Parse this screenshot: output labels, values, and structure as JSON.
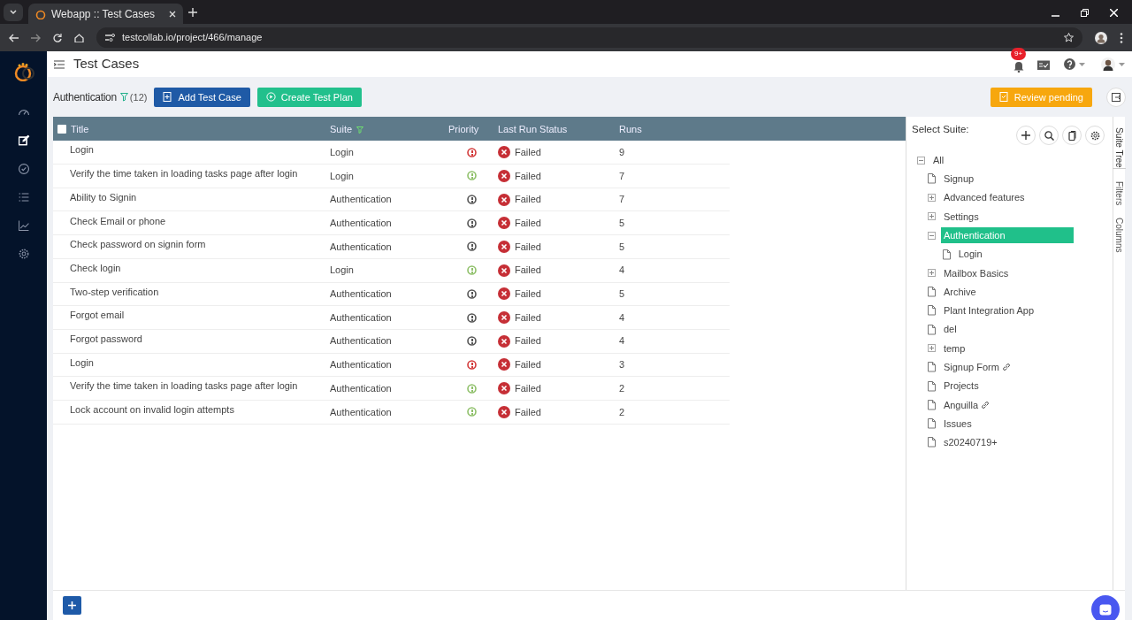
{
  "browser": {
    "tab_title": "Webapp :: Test Cases",
    "url": "testcollab.io/project/466/manage"
  },
  "sidebar": {
    "items": [
      {
        "kind": "dashboard",
        "selected": false
      },
      {
        "kind": "edit",
        "selected": true
      },
      {
        "kind": "check",
        "selected": false
      },
      {
        "kind": "list",
        "selected": false
      },
      {
        "kind": "chart",
        "selected": false
      },
      {
        "kind": "settings",
        "selected": false
      }
    ]
  },
  "header": {
    "title": "Test Cases",
    "notification_count": "9+"
  },
  "toolbar": {
    "suite_name": "Authentication",
    "count": "(12)",
    "buttons": [
      {
        "kind": "add",
        "label": "Add Test Case"
      },
      {
        "kind": "plan",
        "label": "Create Test Plan"
      },
      {
        "kind": "review",
        "label": "Review pending"
      }
    ]
  },
  "table": {
    "select_all_checked": false,
    "columns": [
      "Title",
      "Suite",
      "Priority",
      "Last Run Status",
      "Runs"
    ],
    "rows": [
      {
        "title": "Login",
        "suite": "Login",
        "priority": {
          "color": "#d33b3b"
        },
        "status": "Failed",
        "runs": "9"
      },
      {
        "title": "Verify the time taken in loading tasks page after login",
        "suite": "Login",
        "priority": {
          "color": "#8fc06a"
        },
        "status": "Failed",
        "runs": "7"
      },
      {
        "title": "Ability to Signin",
        "suite": "Authentication",
        "priority": {
          "color": "#555555"
        },
        "status": "Failed",
        "runs": "7"
      },
      {
        "title": "Check Email or phone",
        "suite": "Authentication",
        "priority": {
          "color": "#555555"
        },
        "status": "Failed",
        "runs": "5"
      },
      {
        "title": "Check password on signin form",
        "suite": "Authentication",
        "priority": {
          "color": "#555555"
        },
        "status": "Failed",
        "runs": "5"
      },
      {
        "title": "Check login",
        "suite": "Login",
        "priority": {
          "color": "#8fc06a"
        },
        "status": "Failed",
        "runs": "4"
      },
      {
        "title": "Two-step verification",
        "suite": "Authentication",
        "priority": {
          "color": "#555555"
        },
        "status": "Failed",
        "runs": "5"
      },
      {
        "title": "Forgot email",
        "suite": "Authentication",
        "priority": {
          "color": "#555555"
        },
        "status": "Failed",
        "runs": "4"
      },
      {
        "title": "Forgot password",
        "suite": "Authentication",
        "priority": {
          "color": "#555555"
        },
        "status": "Failed",
        "runs": "4"
      },
      {
        "title": "Login",
        "suite": "Authentication",
        "priority": {
          "color": "#d33b3b"
        },
        "status": "Failed",
        "runs": "3"
      },
      {
        "title": "Verify the time taken in loading tasks page after login",
        "suite": "Authentication",
        "priority": {
          "color": "#8fc06a"
        },
        "status": "Failed",
        "runs": "2"
      },
      {
        "title": "Lock account on invalid login attempts",
        "suite": "Authentication",
        "priority": {
          "color": "#8fc06a"
        },
        "status": "Failed",
        "runs": "2"
      }
    ]
  },
  "suite_panel": {
    "label": "Select Suite:",
    "tree": [
      {
        "label": "All",
        "kind": "folder",
        "expanded": true,
        "selected": false,
        "linked": false,
        "children": [
          {
            "label": "Signup",
            "kind": "file",
            "selected": false,
            "linked": false
          },
          {
            "label": "Advanced features",
            "kind": "folder",
            "expanded": false,
            "selected": false,
            "linked": false
          },
          {
            "label": "Settings",
            "kind": "folder",
            "expanded": false,
            "selected": false,
            "linked": false
          },
          {
            "label": "Authentication",
            "kind": "folder",
            "expanded": true,
            "selected": true,
            "linked": false,
            "children": [
              {
                "label": "Login",
                "kind": "file",
                "selected": false,
                "linked": false
              }
            ]
          },
          {
            "label": "Mailbox Basics",
            "kind": "folder",
            "expanded": false,
            "selected": false,
            "linked": false
          },
          {
            "label": "Archive",
            "kind": "file",
            "selected": false,
            "linked": false
          },
          {
            "label": "Plant Integration App",
            "kind": "file",
            "selected": false,
            "linked": false
          },
          {
            "label": "del",
            "kind": "file",
            "selected": false,
            "linked": false
          },
          {
            "label": "temp",
            "kind": "folder",
            "expanded": false,
            "selected": false,
            "linked": false
          },
          {
            "label": "Signup Form",
            "kind": "file",
            "selected": false,
            "linked": true
          },
          {
            "label": "Projects",
            "kind": "file",
            "selected": false,
            "linked": false
          },
          {
            "label": "Anguilla",
            "kind": "file",
            "selected": false,
            "linked": true
          },
          {
            "label": "Issues",
            "kind": "file",
            "selected": false,
            "linked": false
          },
          {
            "label": "s20240719+",
            "kind": "file",
            "selected": false,
            "linked": false
          }
        ]
      }
    ],
    "side_tabs": [
      {
        "label": "Suite Tree",
        "selected": true
      },
      {
        "label": "Filters",
        "selected": false
      },
      {
        "label": "Columns",
        "selected": false
      }
    ]
  }
}
